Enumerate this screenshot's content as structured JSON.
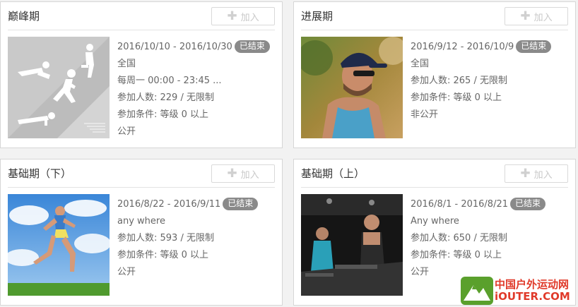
{
  "join_label": "加入",
  "cards": [
    {
      "title": "巅峰期",
      "dates": "2016/10/10 - 2016/10/30",
      "status": "已结束",
      "lines": [
        "全国",
        "每周一 00:00 - 23:45 ...",
        "参加人数: 229 / 无限制",
        "参加条件: 等级 0 以上",
        "公开"
      ]
    },
    {
      "title": "进展期",
      "dates": "2016/9/12 - 2016/10/9",
      "status": "已结束",
      "lines": [
        "全国",
        "参加人数: 265 / 无限制",
        "参加条件: 等级 0 以上",
        "非公开"
      ]
    },
    {
      "title": "基础期（下）",
      "dates": "2016/8/22 - 2016/9/11",
      "status": "已结束",
      "lines": [
        "any where",
        "参加人数: 593 / 无限制",
        "参加条件: 等级 0 以上",
        "公开"
      ]
    },
    {
      "title": "基础期（上）",
      "dates": "2016/8/1 - 2016/8/21",
      "status": "已结束",
      "lines": [
        "Any where",
        "参加人数: 650 / 无限制",
        "参加条件: 等级 0 以上",
        "公开"
      ]
    }
  ],
  "watermark": {
    "line1": "中国户外运动网",
    "line2": "iOUTER.COM",
    "color": "#e03a2a",
    "icon_color": "#5aa02c"
  }
}
